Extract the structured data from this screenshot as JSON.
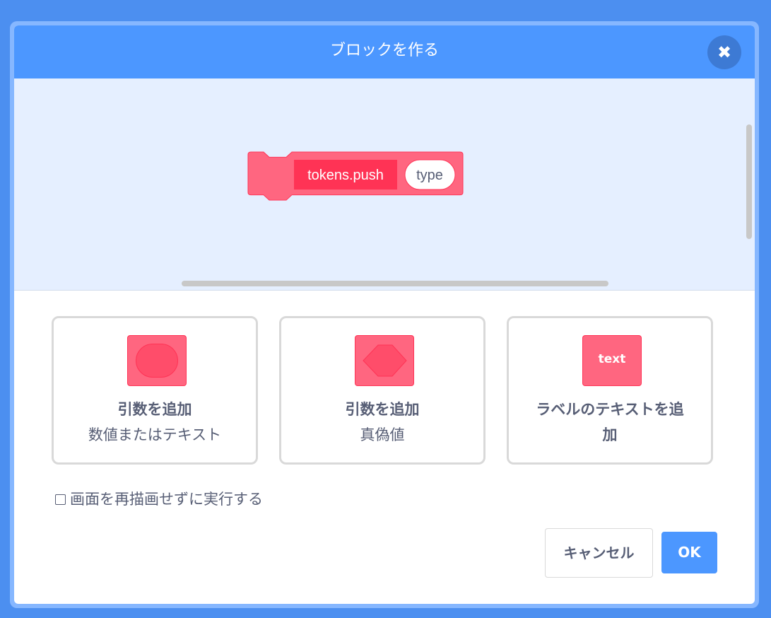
{
  "dialog": {
    "title": "ブロックを作る",
    "close_icon": "close-icon"
  },
  "block": {
    "name": "tokens.push",
    "argument": "type",
    "color": "#ff6680",
    "name_bg": "#ff3355"
  },
  "options": [
    {
      "icon": "oval-input-icon",
      "title": "引数を追加",
      "subtitle": "数値またはテキスト"
    },
    {
      "icon": "hexagon-boolean-icon",
      "title": "引数を追加",
      "subtitle": "真偽値"
    },
    {
      "icon": "text-label-icon",
      "icon_text": "text",
      "title_line1": "ラベルのテキストを追",
      "title_line2": "加"
    }
  ],
  "run_without_refresh": {
    "label": "画面を再描画せずに実行する",
    "checked": false
  },
  "buttons": {
    "cancel": "キャンセル",
    "ok": "OK"
  },
  "colors": {
    "accent": "#4c97ff",
    "block_pink": "#ff6680",
    "text_gray": "#575e75"
  }
}
